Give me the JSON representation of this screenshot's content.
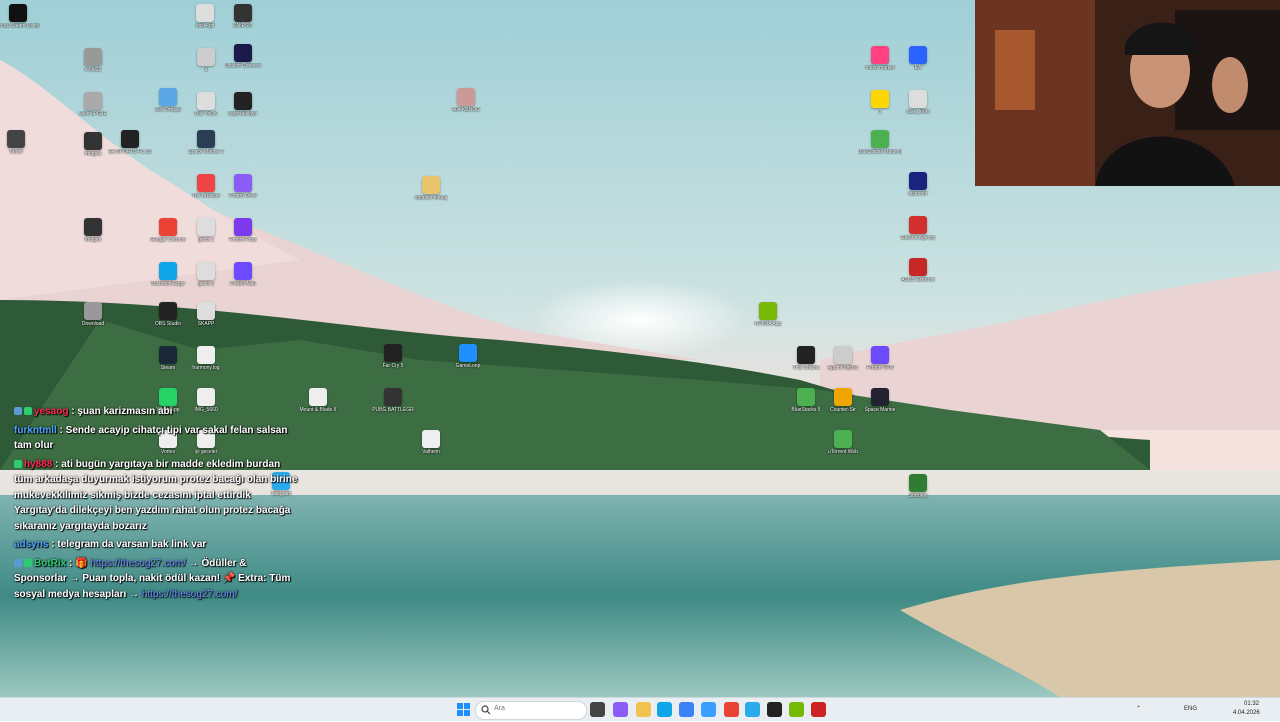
{
  "desktop": {
    "icons": [
      {
        "label": "Bo Bu Steam Utility Pro",
        "color": "#111"
      },
      {
        "label": "ahsl4.gif",
        "color": "#ddd"
      },
      {
        "label": "SNIPSIT",
        "color": "#333"
      },
      {
        "label": "n 6bt32",
        "color": "#999"
      },
      {
        "label": "a",
        "color": "#ccc"
      },
      {
        "label": "Ubisoft Connect",
        "color": "#1b1b4b"
      },
      {
        "label": "walor jPGJE",
        "color": "#aaa"
      },
      {
        "label": "Ses Ortuşle",
        "color": "#5ba7e6"
      },
      {
        "label": "Dav YoOK",
        "color": "#ddd"
      },
      {
        "label": "kayit bekliyor",
        "color": "#222"
      },
      {
        "label": "404 KBNOR",
        "color": "#c99"
      },
      {
        "label": "Images",
        "color": "#333"
      },
      {
        "label": "EA SPORTS FC 25",
        "color": "#222"
      },
      {
        "label": "Space Marine 2",
        "color": "#2a3d55"
      },
      {
        "label": "Tamer",
        "color": "#444"
      },
      {
        "label": "The Browser",
        "color": "#e44"
      },
      {
        "label": "Proton Drive",
        "color": "#8b5cf6"
      },
      {
        "label": "indirilen mesaj",
        "color": "#e9c46a"
      },
      {
        "label": "Images",
        "color": "#333"
      },
      {
        "label": "Google Chrome",
        "color": "#ea4335"
      },
      {
        "label": "gecis 1",
        "color": "#ddd"
      },
      {
        "label": "Proton Pass",
        "color": "#7c3aed"
      },
      {
        "label": "Microsoft Edge",
        "color": "#0ea5e9"
      },
      {
        "label": "gecis 2",
        "color": "#ddd"
      },
      {
        "label": "Proton Mail",
        "color": "#6d4aff"
      },
      {
        "label": "Download",
        "color": "#999"
      },
      {
        "label": "OBS Studio",
        "color": "#222"
      },
      {
        "label": "SKAPP",
        "color": "#ddd"
      },
      {
        "label": "NVIDIA App",
        "color": "#76b900"
      },
      {
        "label": "Steam",
        "color": "#1b2838"
      },
      {
        "label": "harmony.log",
        "color": "#eee"
      },
      {
        "label": "Far Cry 5",
        "color": "#222"
      },
      {
        "label": "GameLoop",
        "color": "#1e90ff"
      },
      {
        "label": "This Charac",
        "color": "#222"
      },
      {
        "label": "App of Mythic",
        "color": "#ccc"
      },
      {
        "label": "Proton VPN",
        "color": "#6d4aff"
      },
      {
        "label": "WhatsApp",
        "color": "#25d366"
      },
      {
        "label": "IMG_5660",
        "color": "#eee"
      },
      {
        "label": "Mount & Blade II",
        "color": "#eee"
      },
      {
        "label": "PUBG BATTLEGR",
        "color": "#333"
      },
      {
        "label": "BlueStacks 5",
        "color": "#4caf50"
      },
      {
        "label": "Counter-Str",
        "color": "#f0a500"
      },
      {
        "label": "Space Marine",
        "color": "#223"
      },
      {
        "label": "Vortex",
        "color": "#eee"
      },
      {
        "label": "iyi geceler",
        "color": "#eee"
      },
      {
        "label": "Valheim",
        "color": "#eee"
      },
      {
        "label": "uTorrent Web",
        "color": "#4caf50"
      },
      {
        "label": "Telegram",
        "color": "#2aabee"
      },
      {
        "label": "Stardew",
        "color": "#2e7d32"
      },
      {
        "label": "EA",
        "color": "#2962ff"
      },
      {
        "label": "metin market",
        "color": "#ff4081"
      },
      {
        "label": "1",
        "color": "#ffd700"
      },
      {
        "label": "task_tenki",
        "color": "#ddd"
      },
      {
        "label": "BlueStacks Multi-Insta",
        "color": "#4caf50"
      },
      {
        "label": "dishonor",
        "color": "#1a237e"
      },
      {
        "label": "Garena Agency",
        "color": "#d32f2f"
      },
      {
        "label": "ASUS Extreme",
        "color": "#c62828"
      }
    ]
  },
  "chat": {
    "messages": [
      {
        "user": "yesaog",
        "user_color": "#ff2d55",
        "text": ": şuan karizmasın abi",
        "badges": [
          "#5b9bd5",
          "#2ecc71"
        ]
      },
      {
        "user": "furkntmll",
        "user_color": "#4aa3ff",
        "text": ": Sende acayip cihatçı tipi var sakal felan salsan tam olur",
        "badges": []
      },
      {
        "user": "hy888",
        "user_color": "#ff2d55",
        "text": ": ati bugün yargıtaya bir madde ekledim burdan tüm arkadaşa duyurmak istiyorum protez bacağı olan birine mukevekkilimiz sikmiş bizde cezasını iptal ettirdik Yargıtay'da dilekçeyi ben yazdım rahat olun protez bacağa sıkaranız yargıtayda bozarız",
        "badges": [
          "#2ecc71"
        ]
      },
      {
        "user": "adsyns",
        "user_color": "#4aa3ff",
        "text": ": telegram da varsan bak link var",
        "badges": []
      },
      {
        "user": "BotRix",
        "user_color": "#2ecc71",
        "text": ": 🎁",
        "link": "https://thesog27.com/",
        "text2": "→ Ödüller & Sponsorlar → Puan topla, nakit ödül kazan! 📌 Extra: Tüm sosyal medya hesapları →",
        "link2": "https://thesog27.com/",
        "badges": [
          "#5b9bd5",
          "#2ecc71"
        ]
      }
    ]
  },
  "taskbar": {
    "search_placeholder": "Ara",
    "language": "ENG",
    "time": "01:32",
    "date": "4.04.2026",
    "items": [
      {
        "name": "start-button",
        "color": "#1e90ff"
      },
      {
        "name": "task-view-button",
        "color": "#444"
      },
      {
        "name": "copilot-button",
        "color": "#8b5cf6"
      },
      {
        "name": "file-explorer-button",
        "color": "#f2c14e"
      },
      {
        "name": "edge-button",
        "color": "#0ea5e9"
      },
      {
        "name": "store-button",
        "color": "#3b82f6"
      },
      {
        "name": "vpn-button",
        "color": "#3aa0ff"
      },
      {
        "name": "chrome-button",
        "color": "#ea4335"
      },
      {
        "name": "telegram-button",
        "color": "#2aabee"
      },
      {
        "name": "app-button",
        "color": "#222"
      },
      {
        "name": "nvidia-button",
        "color": "#76b900"
      },
      {
        "name": "obs-button",
        "color": "#cc2222"
      }
    ]
  }
}
